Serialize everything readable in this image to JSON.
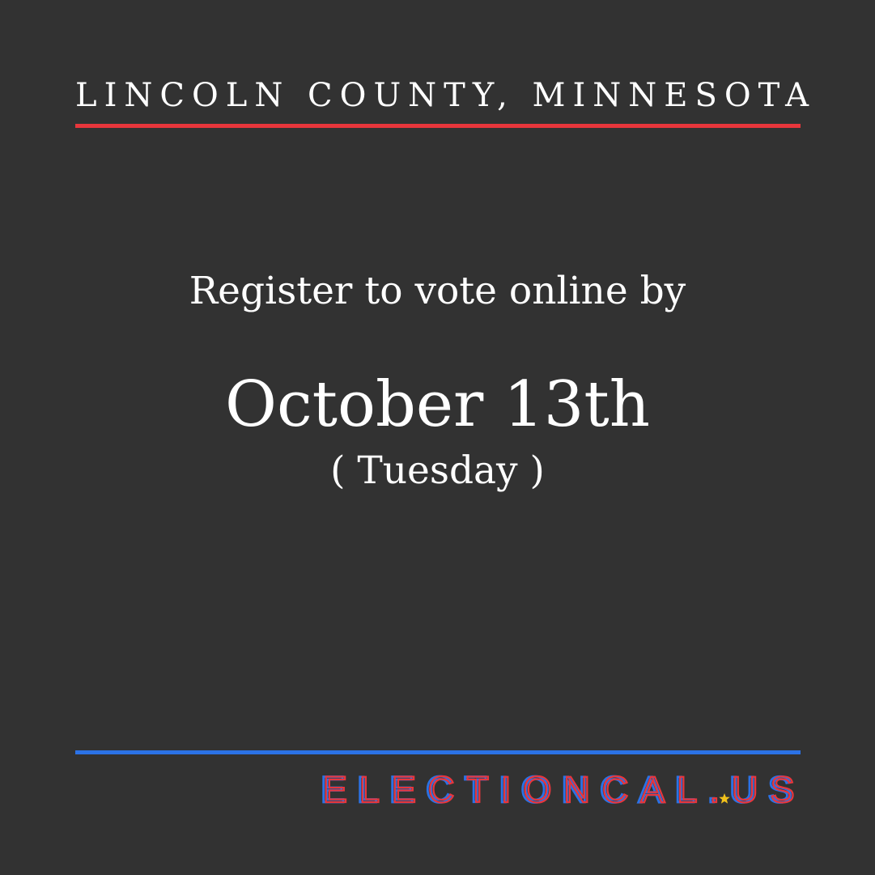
{
  "header": {
    "county": "LINCOLN COUNTY, MINNESOTA"
  },
  "main": {
    "register_text": "Register to vote online by",
    "date_text": "October 13th",
    "weekday_text": "( Tuesday )"
  },
  "footer": {
    "logo_text": "ELECTIONCAL.US"
  },
  "colors": {
    "background": "#323232",
    "text": "#ffffff",
    "red_accent": "#e8363c",
    "blue_accent": "#2b72e6",
    "star": "#f2c21b"
  },
  "icons": {
    "logo_dot": "star-icon"
  }
}
